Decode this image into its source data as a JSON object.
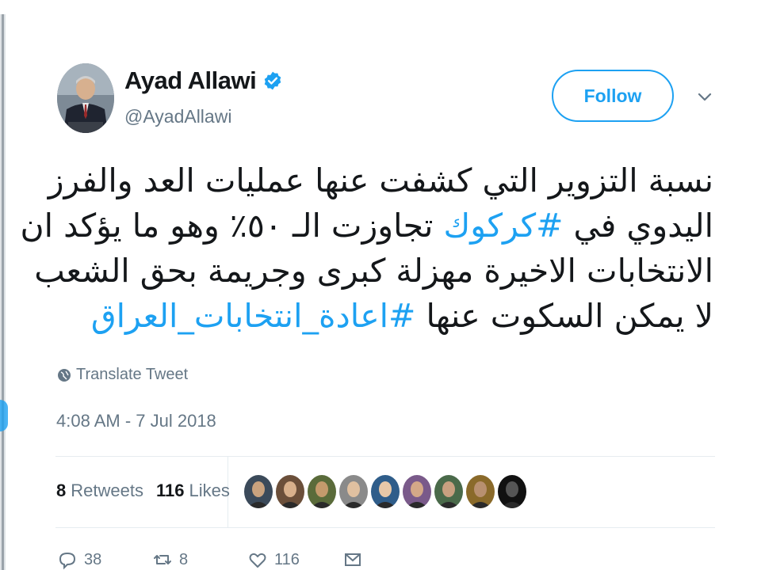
{
  "user": {
    "display_name": "Ayad Allawi",
    "handle": "@AyadAllawi",
    "verified_icon": "verified-badge-icon"
  },
  "follow_label": "Follow",
  "tweet": {
    "line1": "نسبة التزوير التي كشفت عنها عمليات العد والفرز",
    "line2_a": "اليدوي في ",
    "line2_hashtag": "#كركوك",
    "line2_b": " تجاوزت الـ ٥٠٪ وهو ما يؤكد ان",
    "line3": "الانتخابات الاخيرة مهزلة كبرى وجريمة بحق الشعب",
    "line4_a": "لا يمكن السكوت عنها ",
    "line4_hashtag": "#اعادة_انتخابات_العراق"
  },
  "translate_label": "Translate Tweet",
  "timestamp": "4:08 AM - 7 Jul 2018",
  "stats": {
    "retweets_count": "8",
    "retweets_label": "Retweets",
    "likes_count": "116",
    "likes_label": "Likes"
  },
  "actions": {
    "reply_count": "38",
    "retweet_count": "8",
    "like_count": "116"
  },
  "colors": {
    "accent": "#1da1f2",
    "text": "#14171a",
    "muted": "#657786"
  },
  "likers": [
    {
      "bg": "#3b4a5a",
      "face": "#c9a27e"
    },
    {
      "bg": "#6b4f3a",
      "face": "#d8b08c"
    },
    {
      "bg": "#5a6b3a",
      "face": "#c49a6c"
    },
    {
      "bg": "#8a8a8a",
      "face": "#e0c0a0"
    },
    {
      "bg": "#2f5d8a",
      "face": "#e8c8a8"
    },
    {
      "bg": "#7a5a8a",
      "face": "#d4a888"
    },
    {
      "bg": "#4a6a4a",
      "face": "#c8a080"
    },
    {
      "bg": "#8a6a2a",
      "face": "#b89070"
    },
    {
      "bg": "#111111",
      "face": "#555555"
    }
  ]
}
